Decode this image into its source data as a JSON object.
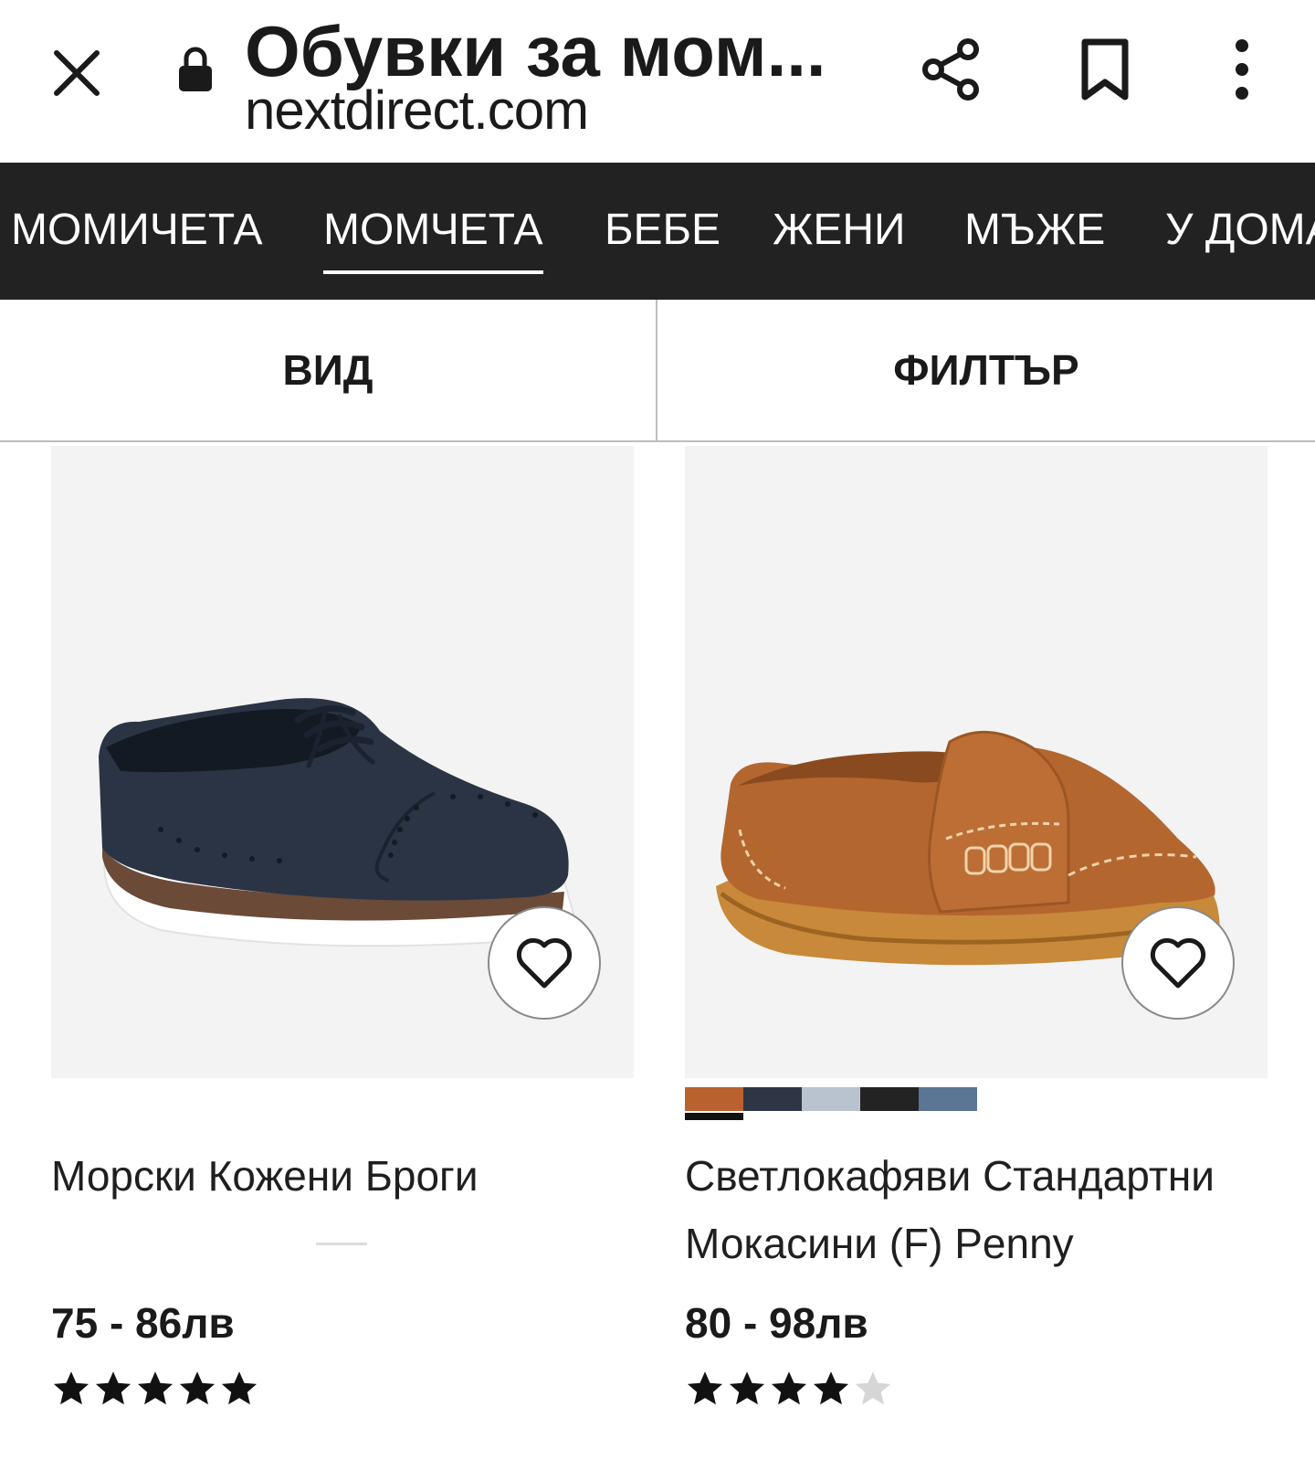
{
  "browser": {
    "page_title": "Обувки за мом...",
    "url": "nextdirect.com",
    "icons": {
      "close": "close-icon",
      "lock": "lock-icon",
      "share": "share-icon",
      "bookmark": "bookmark-icon",
      "menu": "more-vert-icon"
    }
  },
  "category_nav": {
    "tabs": [
      {
        "label": "МОМИЧЕТА",
        "active": false
      },
      {
        "label": "МОМЧЕТА",
        "active": true
      },
      {
        "label": "БЕБЕ",
        "active": false
      },
      {
        "label": "ЖЕНИ",
        "active": false
      },
      {
        "label": "МЪЖЕ",
        "active": false
      },
      {
        "label": "У ДОМА",
        "active": false
      }
    ]
  },
  "toolbar": {
    "view_label": "ВИД",
    "filter_label": "ФИЛТЪР"
  },
  "products": [
    {
      "name": "Морски Кожени Броги",
      "price": "75 - 86лв",
      "rating": 5,
      "rating_max": 5,
      "swatches": []
    },
    {
      "name": "Светлокафяви Стандартни Мокасини (F) Penny",
      "price": "80 - 98лв",
      "rating": 4,
      "rating_max": 5,
      "swatches": [
        "#b9622d",
        "#2e3646",
        "#b8c3cf",
        "#232323",
        "#5b7594"
      ],
      "selected_swatch": 0
    }
  ],
  "colors": {
    "nav_background": "#222222",
    "star_filled": "#111111",
    "star_empty": "#d6d6d6",
    "image_background": "#f3f3f3"
  }
}
